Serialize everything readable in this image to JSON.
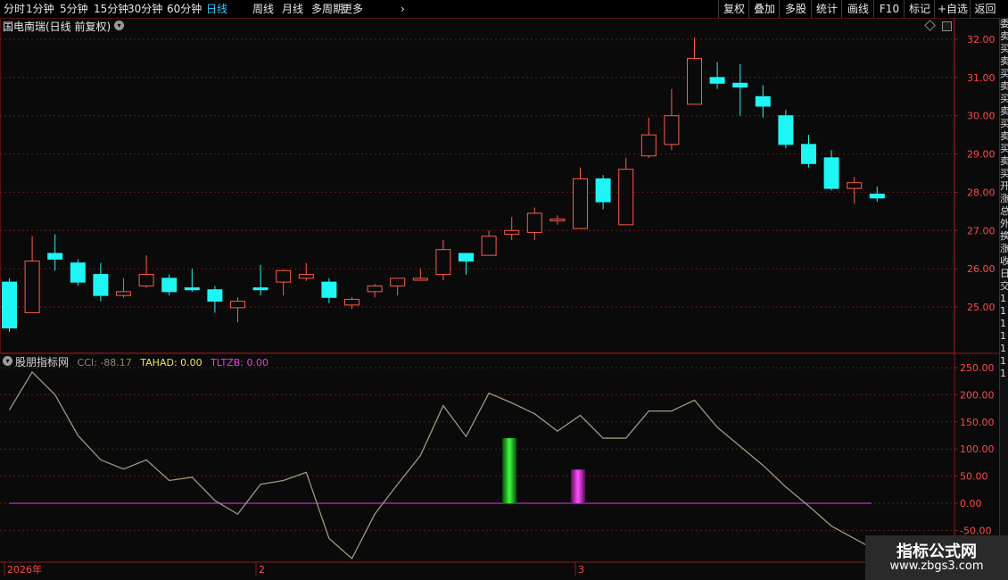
{
  "toolbar": {
    "periods": [
      "分时",
      "1分钟",
      "5分钟",
      "15分钟",
      "30分钟",
      "60分钟",
      "日线",
      "周线",
      "月线",
      "多周期",
      "更多"
    ],
    "active_period": "日线",
    "more_chevron": "›",
    "buttons": [
      "复权",
      "叠加",
      "多股",
      "统计",
      "画线",
      "F10",
      "标记",
      "+自选",
      "返回"
    ]
  },
  "chart_header": {
    "title": "国电南瑞(日线 前复权)"
  },
  "indicator": {
    "name": "股朋指标网",
    "cci_label": "CCI: -88.17",
    "tahad_label": "TAHAD: 0.00",
    "tltzb_label": "TLTZB: 0.00",
    "colors": {
      "cci": "#a9a98c",
      "tahad": "#e8e850",
      "tltzb": "#e040e0",
      "title": "#d8d8d8"
    }
  },
  "colors": {
    "up": "#ff5a4a",
    "down": "#1ef6f6",
    "grid": "#6a1a1a",
    "axis_text": "#ff4a4a",
    "zero_line": "#e040e0",
    "cci_line": "#9a9a80"
  },
  "right_strip_chars": [
    "委",
    "卖",
    "买",
    "卖",
    "买",
    "卖",
    "买",
    "卖",
    "买",
    "卖",
    "买",
    "卖",
    "买",
    "开",
    "涨",
    "总",
    "外",
    "换",
    "涨",
    "收",
    "日",
    "交",
    "1",
    "1",
    "1",
    "1",
    "1",
    "1",
    "1"
  ],
  "date_labels": [
    "2026年",
    "2",
    "3"
  ],
  "watermark": {
    "title": "指标公式网",
    "url": "www.zbgs3.com"
  },
  "chart_data": [
    {
      "type": "candlestick",
      "title": "国电南瑞(日线 前复权)",
      "yticks": [
        32.0,
        31.0,
        30.0,
        29.0,
        28.0,
        27.0,
        26.0,
        25.0
      ],
      "ytick_labels": [
        "32.00",
        "31.00",
        "30.00",
        "29.00",
        "28.00",
        "27.00",
        "26.00",
        "25.00"
      ],
      "ylim": [
        24.1,
        32.4
      ],
      "candles": [
        {
          "o": 25.65,
          "h": 25.75,
          "l": 24.35,
          "c": 24.45
        },
        {
          "o": 24.85,
          "h": 26.85,
          "l": 24.85,
          "c": 26.2
        },
        {
          "o": 26.4,
          "h": 26.9,
          "l": 25.95,
          "c": 26.25
        },
        {
          "o": 26.15,
          "h": 26.25,
          "l": 25.55,
          "c": 25.65
        },
        {
          "o": 25.85,
          "h": 26.15,
          "l": 25.15,
          "c": 25.3
        },
        {
          "o": 25.3,
          "h": 25.75,
          "l": 25.25,
          "c": 25.4
        },
        {
          "o": 25.55,
          "h": 26.35,
          "l": 25.5,
          "c": 25.85
        },
        {
          "o": 25.75,
          "h": 25.85,
          "l": 25.3,
          "c": 25.4
        },
        {
          "o": 25.5,
          "h": 26.0,
          "l": 25.4,
          "c": 25.45
        },
        {
          "o": 25.45,
          "h": 25.55,
          "l": 24.85,
          "c": 25.15
        },
        {
          "o": 24.98,
          "h": 25.25,
          "l": 24.6,
          "c": 25.15
        },
        {
          "o": 25.5,
          "h": 26.1,
          "l": 25.3,
          "c": 25.45
        },
        {
          "o": 25.65,
          "h": 25.98,
          "l": 25.3,
          "c": 25.95
        },
        {
          "o": 25.75,
          "h": 26.15,
          "l": 25.68,
          "c": 25.85
        },
        {
          "o": 25.65,
          "h": 25.75,
          "l": 25.1,
          "c": 25.25
        },
        {
          "o": 25.05,
          "h": 25.25,
          "l": 24.95,
          "c": 25.2
        },
        {
          "o": 25.4,
          "h": 25.6,
          "l": 25.25,
          "c": 25.55
        },
        {
          "o": 25.55,
          "h": 25.75,
          "l": 25.3,
          "c": 25.75
        },
        {
          "o": 25.7,
          "h": 26.0,
          "l": 25.7,
          "c": 25.75
        },
        {
          "o": 25.85,
          "h": 26.75,
          "l": 25.7,
          "c": 26.5
        },
        {
          "o": 26.4,
          "h": 26.4,
          "l": 25.85,
          "c": 26.2
        },
        {
          "o": 26.35,
          "h": 27.0,
          "l": 26.35,
          "c": 26.85
        },
        {
          "o": 26.9,
          "h": 27.35,
          "l": 26.75,
          "c": 27.0
        },
        {
          "o": 26.95,
          "h": 27.6,
          "l": 26.75,
          "c": 27.45
        },
        {
          "o": 27.25,
          "h": 27.4,
          "l": 27.15,
          "c": 27.3
        },
        {
          "o": 27.05,
          "h": 28.65,
          "l": 27.05,
          "c": 28.35
        },
        {
          "o": 28.35,
          "h": 28.45,
          "l": 27.55,
          "c": 27.75
        },
        {
          "o": 27.15,
          "h": 28.9,
          "l": 27.15,
          "c": 28.6
        },
        {
          "o": 28.95,
          "h": 29.95,
          "l": 28.9,
          "c": 29.5
        },
        {
          "o": 29.25,
          "h": 30.7,
          "l": 29.1,
          "c": 30.0
        },
        {
          "o": 30.3,
          "h": 32.05,
          "l": 30.3,
          "c": 31.5
        },
        {
          "o": 31.0,
          "h": 31.4,
          "l": 30.7,
          "c": 30.85
        },
        {
          "o": 30.85,
          "h": 31.35,
          "l": 30.0,
          "c": 30.75
        },
        {
          "o": 30.5,
          "h": 30.8,
          "l": 29.95,
          "c": 30.25
        },
        {
          "o": 30.0,
          "h": 30.15,
          "l": 29.15,
          "c": 29.25
        },
        {
          "o": 29.25,
          "h": 29.5,
          "l": 28.65,
          "c": 28.75
        },
        {
          "o": 28.9,
          "h": 29.1,
          "l": 28.05,
          "c": 28.1
        },
        {
          "o": 28.1,
          "h": 28.4,
          "l": 27.7,
          "c": 28.25
        },
        {
          "o": 27.95,
          "h": 28.15,
          "l": 27.75,
          "c": 27.85
        }
      ]
    },
    {
      "type": "line",
      "title": "股朋指标网",
      "yticks": [
        250,
        200,
        150,
        100,
        50,
        0,
        -50
      ],
      "ytick_labels": [
        "250.00",
        "200.00",
        "150.00",
        "100.00",
        "50.00",
        "0.00",
        "-50.00"
      ],
      "ylim": [
        -105,
        275
      ],
      "series": [
        {
          "name": "CCI",
          "values": [
            172,
            242,
            200,
            125,
            80,
            63,
            80,
            42,
            48,
            5,
            -20,
            35,
            42,
            57,
            -65,
            -102,
            -20,
            35,
            88,
            180,
            123,
            203,
            185,
            165,
            133,
            162,
            120,
            120,
            170,
            170,
            190,
            140,
            105,
            70,
            30,
            -5,
            -42,
            -65,
            -88
          ]
        }
      ],
      "bars": [
        {
          "name": "TAHAD",
          "x_index": 21.9,
          "value": 120,
          "color": "green"
        },
        {
          "name": "TLTZB",
          "x_index": 24.9,
          "value": 62,
          "color": "magenta"
        }
      ],
      "zero_line": 0
    }
  ]
}
